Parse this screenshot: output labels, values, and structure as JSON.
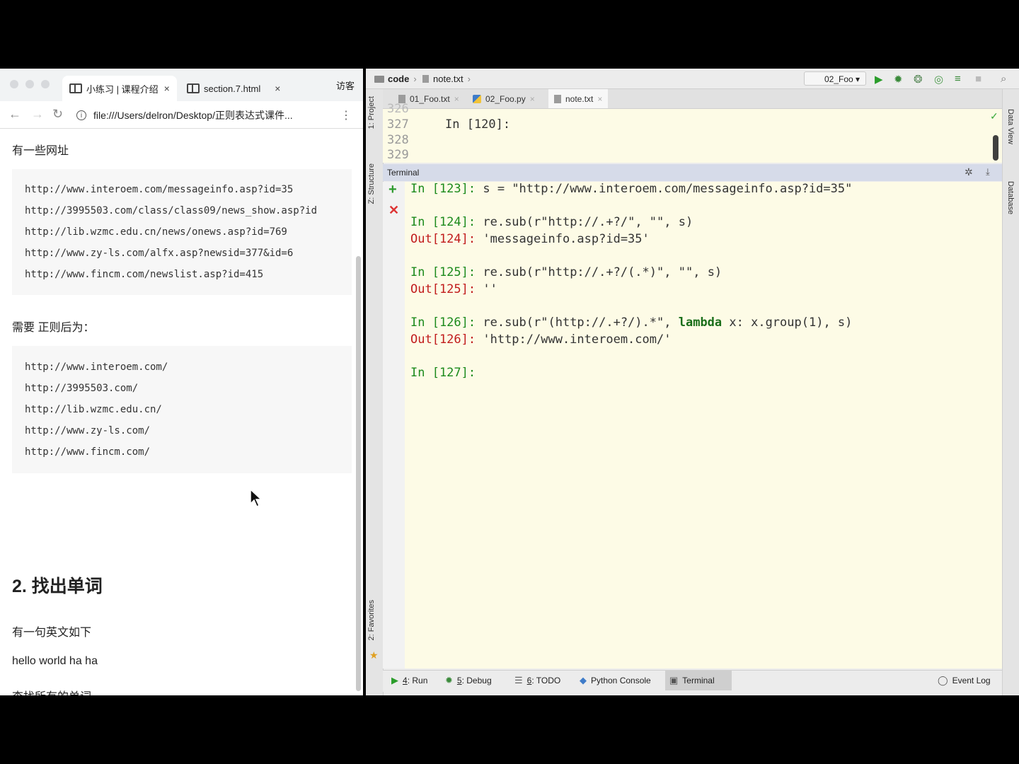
{
  "browser": {
    "tabs": [
      {
        "label": "小练习 | 课程介绍",
        "close": "×"
      },
      {
        "label": "section.7.html",
        "close": "×"
      }
    ],
    "guest_label": "访客",
    "url": "file:///Users/delron/Desktop/正则表达式课件...",
    "content": {
      "intro": "有一些网址",
      "urls": [
        "http://www.interoem.com/messageinfo.asp?id=35",
        "http://3995503.com/class/class09/news_show.asp?id",
        "http://lib.wzmc.edu.cn/news/onews.asp?id=769",
        "http://www.zy-ls.com/alfx.asp?newsid=377&id=6",
        "http://www.fincm.com/newslist.asp?id=415"
      ],
      "need": "需要 正则后为：",
      "results": [
        "http://www.interoem.com/",
        "http://3995503.com/",
        "http://lib.wzmc.edu.cn/",
        "http://www.zy-ls.com/",
        "http://www.fincm.com/"
      ],
      "heading": "2. 找出单词",
      "sentence_intro": "有一句英文如下",
      "sentence": "hello world ha ha",
      "task": "查找所有的单词"
    }
  },
  "ide": {
    "breadcrumb": [
      "code",
      "note.txt"
    ],
    "run_config": "02_Foo",
    "editor_tabs": [
      {
        "label": "01_Foo.txt",
        "close": "×"
      },
      {
        "label": "02_Foo.py",
        "close": "×"
      },
      {
        "label": "note.txt",
        "close": "×"
      }
    ],
    "editor": {
      "line_numbers": [
        "326",
        "327",
        "328",
        "329"
      ],
      "code_line": "In [120]:"
    },
    "terminal_title": "Terminal",
    "terminal": {
      "l1_prompt": "In [123]:",
      "l1_code": " s = ",
      "l1_str": "\"http://www.interoem.com/messageinfo.asp?id=35\"",
      "l2_prompt": "In [124]:",
      "l2_code_a": " re.sub(",
      "l2_str_a": "r\"http://.+?/\"",
      "l2_code_b": ", ",
      "l2_str_b": "\"\"",
      "l2_code_c": ", s)",
      "l3_prompt": "Out[124]:",
      "l3_val": " 'messageinfo.asp?id=35'",
      "l4_prompt": "In [125]:",
      "l4_code_a": " re.sub(",
      "l4_str_a": "r\"http://.+?/(.*)\"",
      "l4_code_b": ", ",
      "l4_str_b": "\"\"",
      "l4_code_c": ", s)",
      "l5_prompt": "Out[125]:",
      "l5_val": " ''",
      "l6_prompt": "In [126]:",
      "l6_code_a": " re.sub(",
      "l6_str_a": "r\"(http://.+?/).*\"",
      "l6_code_b": ", ",
      "l6_kw": "lambda",
      "l6_code_c": " x: x.group(1), s)",
      "l7_prompt": "Out[126]:",
      "l7_val": " 'http://www.interoem.com/'",
      "l8_prompt": "In [127]:"
    },
    "left_tools": [
      "1: Project",
      "Z: Structure",
      "2: Favorites"
    ],
    "right_tools": [
      "Data View",
      "Database"
    ],
    "bottom_tools": [
      {
        "key": "4",
        "label": ": Run"
      },
      {
        "key": "5",
        "label": ": Debug"
      },
      {
        "key": "6",
        "label": ": TODO"
      },
      {
        "key": "",
        "label": "Python Console"
      },
      {
        "key": "",
        "label": "Terminal"
      }
    ],
    "event_log": "Event Log",
    "colors": {
      "prompt_in": "#1c8a1c",
      "prompt_out": "#c11c1c",
      "terminal_bg": "#fdfbe6"
    }
  }
}
